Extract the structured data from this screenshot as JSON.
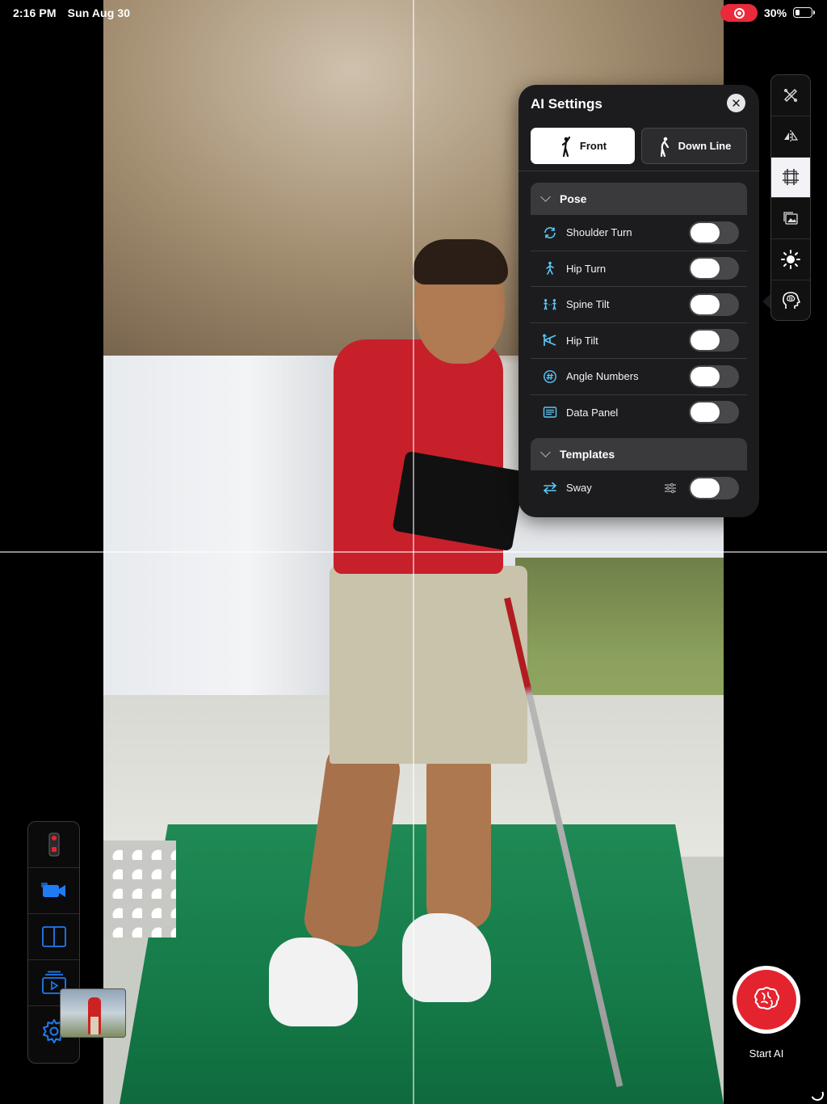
{
  "status_bar": {
    "time": "2:16 PM",
    "date": "Sun Aug 30",
    "battery": "30%",
    "battery_level": 0.3
  },
  "ai_settings": {
    "title": "AI Settings",
    "view_tabs": [
      {
        "label": "Front",
        "icon": "golfer-front-icon",
        "selected": true
      },
      {
        "label": "Down Line",
        "icon": "golfer-down-line-icon",
        "selected": false
      }
    ],
    "pose": {
      "header": "Pose",
      "items": [
        {
          "label": "Shoulder Turn",
          "icon": "shoulder-turn-icon",
          "enabled": false
        },
        {
          "label": "Hip Turn",
          "icon": "hip-turn-icon",
          "enabled": false
        },
        {
          "label": "Spine Tilt",
          "icon": "spine-tilt-icon",
          "enabled": false
        },
        {
          "label": "Hip Tilt",
          "icon": "hip-tilt-icon",
          "enabled": false
        },
        {
          "label": "Angle Numbers",
          "icon": "angle-numbers-icon",
          "enabled": false
        },
        {
          "label": "Data Panel",
          "icon": "data-panel-icon",
          "enabled": false
        }
      ]
    },
    "templates": {
      "header": "Templates",
      "items": [
        {
          "label": "Sway",
          "icon": "sway-icon",
          "enabled": false,
          "has_settings": true
        }
      ]
    }
  },
  "right_toolbar": [
    {
      "icon": "drawing-tools-icon",
      "active": false
    },
    {
      "icon": "flip-icon",
      "active": false
    },
    {
      "icon": "grid-icon",
      "active": true
    },
    {
      "icon": "picture-in-picture-icon",
      "active": false
    },
    {
      "icon": "brightness-icon",
      "active": false
    },
    {
      "icon": "ai-brain-head-icon",
      "active": false
    }
  ],
  "left_toolbar": [
    {
      "icon": "remote-icon"
    },
    {
      "icon": "video-camera-icon"
    },
    {
      "icon": "split-view-icon"
    },
    {
      "icon": "playlist-icon"
    },
    {
      "icon": "settings-gear-icon"
    }
  ],
  "start_ai": {
    "label": "Start AI"
  },
  "colors": {
    "accent_red": "#e3242f",
    "panel_bg": "#1c1c1e",
    "accent_blue": "#1f7bf2",
    "icon_teal": "#5ac8fa"
  }
}
